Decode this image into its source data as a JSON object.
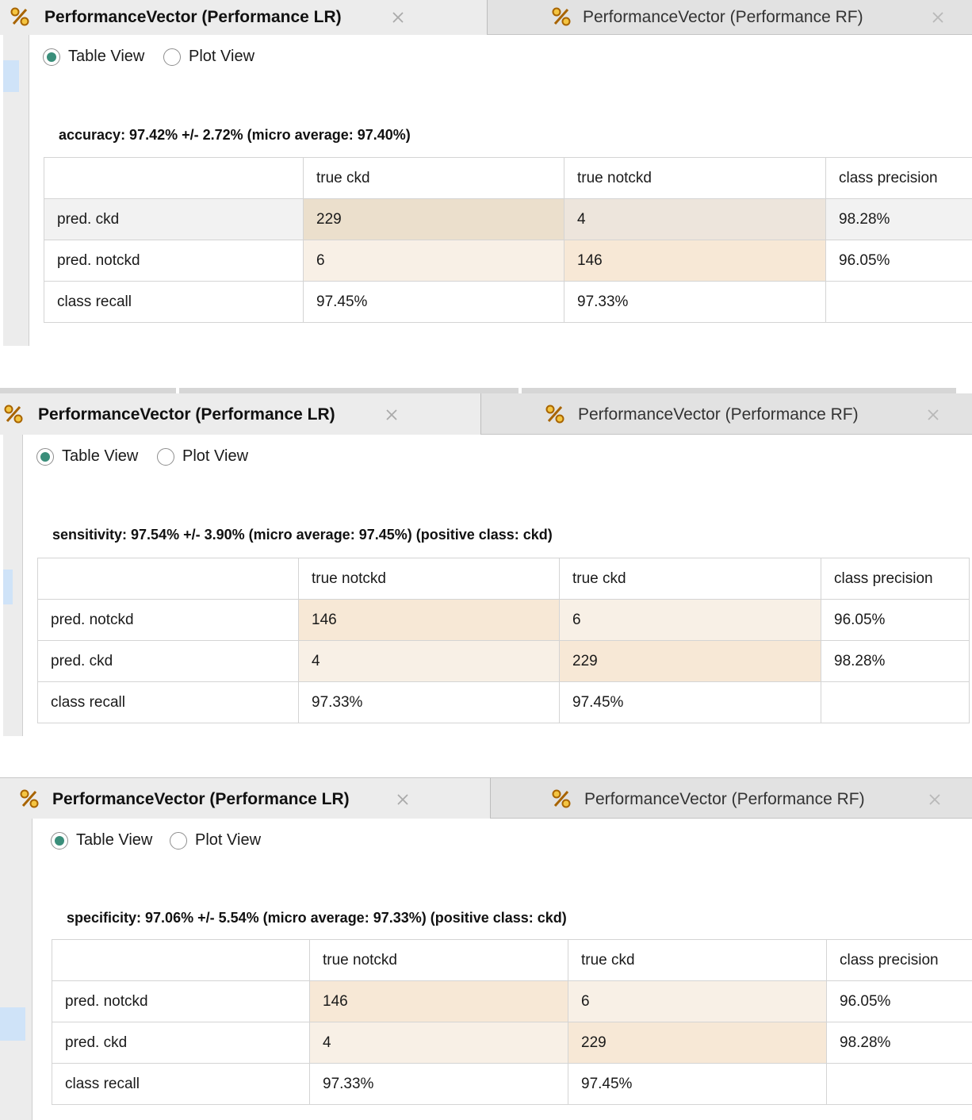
{
  "tabs": {
    "active_title": "PerformanceVector (Performance LR)",
    "inactive_title": "PerformanceVector (Performance RF)",
    "icon": "percent-icon",
    "close_icon": "close-icon"
  },
  "view_toggle": {
    "table_view_label": "Table View",
    "plot_view_label": "Plot View",
    "selected": "Table View"
  },
  "colors": {
    "radio_selected": "#3a8e7a",
    "icon_orange": "#d98b00",
    "cell_strong": "#ebdfcc",
    "cell_medium": "#f7e8d6",
    "cell_light": "#f8f0e6"
  },
  "panels": [
    {
      "metric": "accuracy: 97.42% +/- 2.72% (micro average: 97.40%)",
      "header": [
        "",
        "true ckd",
        "true notckd",
        "class precision"
      ],
      "rows": [
        [
          "pred. ckd",
          "229",
          "4",
          "98.28%"
        ],
        [
          "pred. notckd",
          "6",
          "146",
          "96.05%"
        ],
        [
          "class recall",
          "97.45%",
          "97.33%",
          ""
        ]
      ]
    },
    {
      "metric": "sensitivity: 97.54% +/- 3.90% (micro average: 97.45%) (positive class: ckd)",
      "header": [
        "",
        "true notckd",
        "true ckd",
        "class precision"
      ],
      "rows": [
        [
          "pred. notckd",
          "146",
          "6",
          "96.05%"
        ],
        [
          "pred. ckd",
          "4",
          "229",
          "98.28%"
        ],
        [
          "class recall",
          "97.33%",
          "97.45%",
          ""
        ]
      ]
    },
    {
      "metric": "specificity: 97.06% +/- 5.54% (micro average: 97.33%) (positive class: ckd)",
      "header": [
        "",
        "true notckd",
        "true ckd",
        "class precision"
      ],
      "rows": [
        [
          "pred. notckd",
          "146",
          "6",
          "96.05%"
        ],
        [
          "pred. ckd",
          "4",
          "229",
          "98.28%"
        ],
        [
          "class recall",
          "97.33%",
          "97.45%",
          ""
        ]
      ]
    }
  ]
}
